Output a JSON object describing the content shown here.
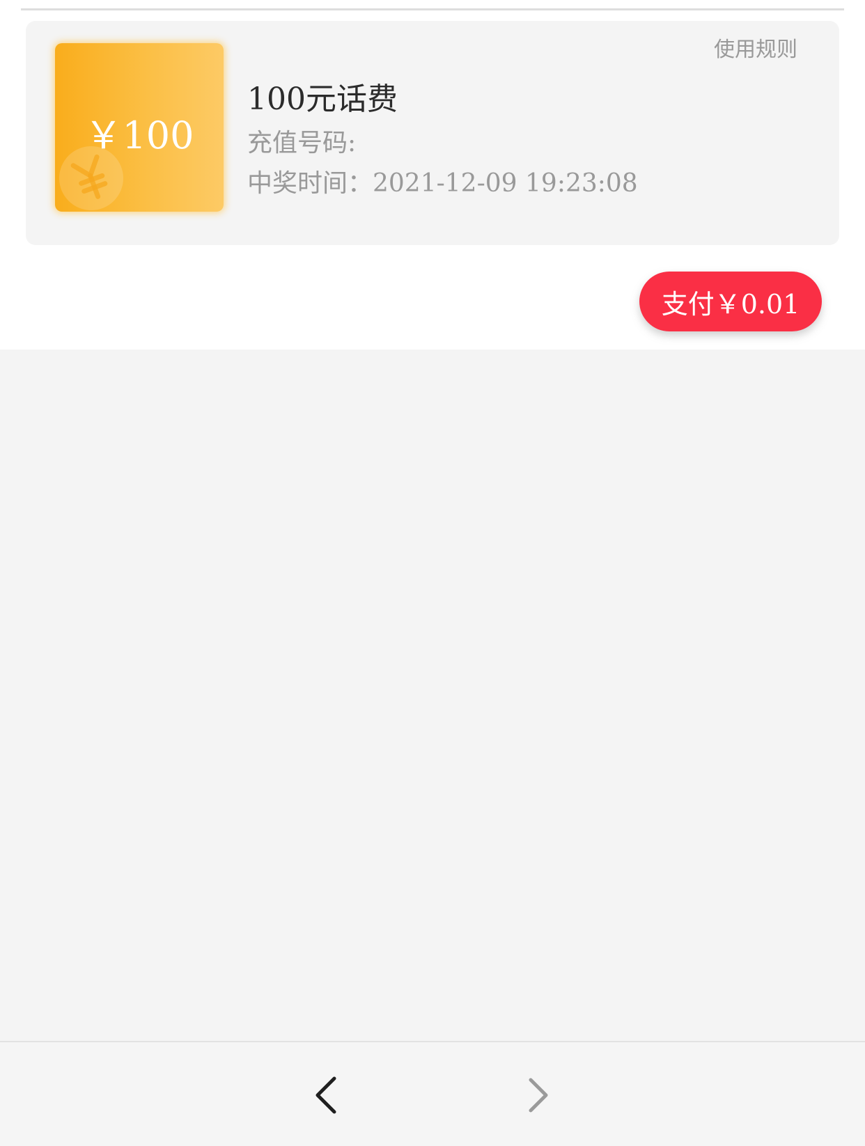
{
  "prize": {
    "usage_rules_label": "使用规则",
    "voucher_amount": "￥100",
    "title": "100元话费",
    "recharge_number_label": "充值号码:",
    "win_time_text": "中奖时间：2021-12-09 19:23:08"
  },
  "pay_button_label": "支付￥0.01",
  "colors": {
    "voucher_gradient_start": "#f9ad1c",
    "voucher_gradient_end": "#fdca65",
    "pay_button": "#fa2f45",
    "page_background": "#f4f4f4"
  },
  "icons": {
    "coin": "yen-coin-icon",
    "back": "chevron-left-icon",
    "forward": "chevron-right-icon"
  }
}
